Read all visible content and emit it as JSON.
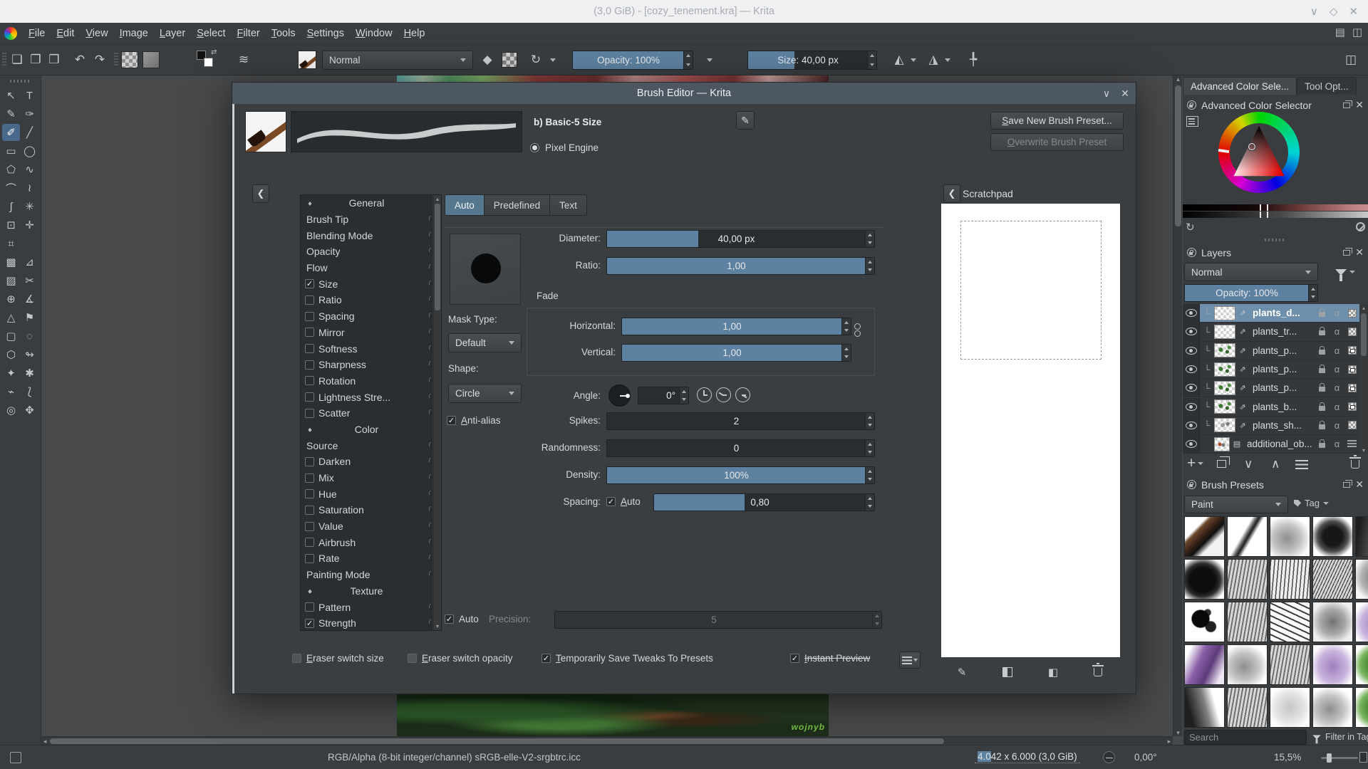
{
  "colors": {
    "accent": "#5d81a1",
    "selection": "#6d8fab",
    "dialog_titlebar": "#4c5761",
    "signature_green": "#76c043"
  },
  "titlebar": {
    "title": "(3,0 GiB) - [cozy_tenement.kra] — Krita"
  },
  "menubar": {
    "items": [
      "File",
      "Edit",
      "View",
      "Image",
      "Layer",
      "Select",
      "Filter",
      "Tools",
      "Settings",
      "Window",
      "Help"
    ]
  },
  "toolbar": {
    "blend_mode": "Normal",
    "opacity": "Opacity: 100%",
    "opacity_fill": 1,
    "size": "Size: 40,00 px",
    "size_fill": 0.36
  },
  "toolbox": {
    "tools": [
      {
        "name": "select-shapes",
        "glyph": "↖"
      },
      {
        "name": "text",
        "glyph": "T"
      },
      {
        "name": "edit-shapes",
        "glyph": "✎"
      },
      {
        "name": "calligraphy",
        "glyph": "✑"
      },
      {
        "name": "freehand-brush",
        "glyph": "✐",
        "active": true
      },
      {
        "name": "line",
        "glyph": "╱"
      },
      {
        "name": "rectangle",
        "glyph": "▭"
      },
      {
        "name": "ellipse",
        "glyph": "◯"
      },
      {
        "name": "polygon",
        "glyph": "⬠"
      },
      {
        "name": "polyline",
        "glyph": "∿"
      },
      {
        "name": "bezier-curve",
        "glyph": "⌒"
      },
      {
        "name": "freehand-path",
        "glyph": "≀"
      },
      {
        "name": "dynamic-brush",
        "glyph": "∫"
      },
      {
        "name": "multibrush",
        "glyph": "✳"
      },
      {
        "name": "transform",
        "glyph": "⊡"
      },
      {
        "name": "move",
        "glyph": "✛"
      },
      {
        "name": "crop",
        "glyph": "⌗"
      },
      {
        "name": "spacer",
        "glyph": "",
        "spacer": true
      },
      {
        "name": "gradient",
        "glyph": "▩"
      },
      {
        "name": "color-sampler",
        "glyph": "⊿"
      },
      {
        "name": "pattern-edit",
        "glyph": "▨"
      },
      {
        "name": "smart-patch",
        "glyph": "✂"
      },
      {
        "name": "colorize-mask",
        "glyph": "⊕"
      },
      {
        "name": "measure",
        "glyph": "∡"
      },
      {
        "name": "assistants",
        "glyph": "△"
      },
      {
        "name": "reference-images",
        "glyph": "⚑"
      },
      {
        "name": "rect-select",
        "glyph": "▢"
      },
      {
        "name": "ellipse-select",
        "glyph": "◌"
      },
      {
        "name": "polygon-select",
        "glyph": "⬡"
      },
      {
        "name": "freehand-select",
        "glyph": "↬"
      },
      {
        "name": "contiguous-select",
        "glyph": "✦"
      },
      {
        "name": "similar-select",
        "glyph": "✱"
      },
      {
        "name": "magnetic-select",
        "glyph": "⌁"
      },
      {
        "name": "bezier-select",
        "glyph": "⟅"
      },
      {
        "name": "zoom",
        "glyph": "◎"
      },
      {
        "name": "pan",
        "glyph": "✥"
      }
    ]
  },
  "canvas": {
    "signature": "wojnyb"
  },
  "dialog": {
    "title": "Brush Editor — Krita",
    "preset_name": "b) Basic-5 Size",
    "engine": "Pixel Engine",
    "save_button": "Save New Brush Preset...",
    "overwrite_button": "Overwrite Brush Preset",
    "scratchpad_title": "Scratchpad",
    "tabs": [
      "Auto",
      "Predefined",
      "Text"
    ],
    "options": [
      {
        "label": "General",
        "type": "header"
      },
      {
        "label": "Brush Tip",
        "type": "plain"
      },
      {
        "label": "Blending Mode",
        "type": "plain"
      },
      {
        "label": "Opacity",
        "type": "plain"
      },
      {
        "label": "Flow",
        "type": "plain"
      },
      {
        "label": "Size",
        "type": "check",
        "checked": true
      },
      {
        "label": "Ratio",
        "type": "check",
        "checked": false
      },
      {
        "label": "Spacing",
        "type": "check",
        "checked": false
      },
      {
        "label": "Mirror",
        "type": "check",
        "checked": false
      },
      {
        "label": "Softness",
        "type": "check",
        "checked": false
      },
      {
        "label": "Sharpness",
        "type": "check",
        "checked": false
      },
      {
        "label": "Rotation",
        "type": "check",
        "checked": false
      },
      {
        "label": "Lightness Stre...",
        "type": "check",
        "checked": false
      },
      {
        "label": "Scatter",
        "type": "check",
        "checked": false
      },
      {
        "label": "Color",
        "type": "header"
      },
      {
        "label": "Source",
        "type": "plain"
      },
      {
        "label": "Darken",
        "type": "check",
        "checked": false
      },
      {
        "label": "Mix",
        "type": "check",
        "checked": false
      },
      {
        "label": "Hue",
        "type": "check",
        "checked": false
      },
      {
        "label": "Saturation",
        "type": "check",
        "checked": false
      },
      {
        "label": "Value",
        "type": "check",
        "checked": false
      },
      {
        "label": "Airbrush",
        "type": "check",
        "checked": false
      },
      {
        "label": "Rate",
        "type": "check",
        "checked": false
      },
      {
        "label": "Painting Mode",
        "type": "plain"
      },
      {
        "label": "Texture",
        "type": "header"
      },
      {
        "label": "Pattern",
        "type": "check",
        "checked": false
      },
      {
        "label": "Strength",
        "type": "check",
        "checked": true
      }
    ],
    "params": {
      "diameter": {
        "label": "Diameter:",
        "value": "40,00 px",
        "fill": 0.34
      },
      "ratio": {
        "label": "Ratio:",
        "value": "1,00",
        "fill": 1
      },
      "fade": "Fade",
      "horizontal": {
        "label": "Horizontal:",
        "value": "1,00",
        "fill": 1
      },
      "vertical": {
        "label": "Vertical:",
        "value": "1,00",
        "fill": 1
      },
      "mask_type": {
        "label": "Mask Type:",
        "value": "Default"
      },
      "shape": {
        "label": "Shape:",
        "value": "Circle"
      },
      "antialias": "Anti-alias",
      "angle": {
        "label": "Angle:",
        "value": "0°"
      },
      "spikes": {
        "label": "Spikes:",
        "value": "2",
        "fill": 0
      },
      "randomness": {
        "label": "Randomness:",
        "value": "0",
        "fill": 0
      },
      "density": {
        "label": "Density:",
        "value": "100%",
        "fill": 1
      },
      "spacing": {
        "label": "Spacing:",
        "auto": "Auto",
        "value": "0,80",
        "fill": 0.41
      },
      "precision": {
        "auto": "Auto",
        "label": "Precision:",
        "value": "5",
        "fill": 0
      }
    },
    "footer": {
      "eraser_size": "Eraser switch size",
      "eraser_opacity": "Eraser switch opacity",
      "save_tweaks": "Temporarily Save Tweaks To Presets",
      "instant_preview": "Instant Preview"
    }
  },
  "docks": {
    "tabs": [
      "Advanced Color Sele...",
      "Tool Opt..."
    ],
    "color_selector_title": "Advanced Color Selector",
    "layers": {
      "title": "Layers",
      "blend_mode": "Normal",
      "opacity": "Opacity: 100%",
      "opacity_fill": 1,
      "rows": [
        {
          "name": "plants_d...",
          "selected": true,
          "right": "plain"
        },
        {
          "name": "plants_tr...",
          "right": "plain"
        },
        {
          "name": "plants_p...",
          "right": "locked",
          "speck": "green"
        },
        {
          "name": "plants_p...",
          "right": "locked",
          "speck": "green"
        },
        {
          "name": "plants_p...",
          "right": "locked",
          "speck": "green"
        },
        {
          "name": "plants_b...",
          "right": "locked",
          "speck": "green"
        },
        {
          "name": "plants_sh...",
          "right": "plain",
          "speck": "gray"
        },
        {
          "name": "additional_ob...",
          "right": "bricks",
          "group": true,
          "speck": "red"
        }
      ]
    },
    "presets": {
      "title": "Brush Presets",
      "tag_filter": "Paint",
      "tag_label": "Tag",
      "search_placeholder": "Search",
      "filter_label": "Filter in Tag",
      "thumbs": [
        "photo",
        "thin",
        "soft",
        "wet",
        "dark",
        "blob",
        "texture",
        "dry",
        "bristle",
        "chalk",
        "splat",
        "texture",
        "rake",
        "smoke",
        "purplesoft",
        "purple",
        "soft",
        "texture",
        "purplesoft",
        "green",
        "fan",
        "texture",
        "pale",
        "soft",
        "green"
      ]
    }
  },
  "statusbar": {
    "profile": "RGB/Alpha (8-bit integer/channel)  sRGB-elle-V2-srgbtrc.icc",
    "dim_selected": "4.0",
    "dim_rest": "42 x 6.000 (3,0 GiB)",
    "rotation": "0,00°",
    "zoom": "15,5%"
  }
}
